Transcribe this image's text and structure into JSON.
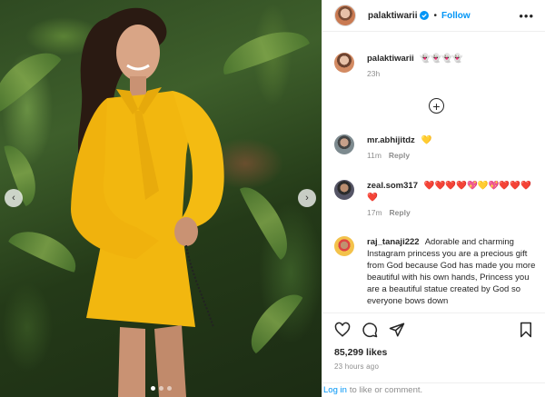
{
  "post": {
    "username": "palaktiwarii",
    "follow_label": "Follow",
    "bullet": "•",
    "more_label": "•••",
    "verified_icon": "verified-badge-icon",
    "accent": "#0095f6"
  },
  "photo": {
    "prev_glyph": "‹",
    "next_glyph": "›",
    "slide_count": 3,
    "active_slide": 1
  },
  "caption": {
    "username": "palaktiwarii",
    "text": "👻👻👻👻",
    "time": "23h"
  },
  "view_replies_glyph": "+",
  "comments": [
    {
      "username": "mr.abhijitdz",
      "text": "💛",
      "time": "11m",
      "reply_label": "Reply"
    },
    {
      "username": "zeal.som317",
      "text": "❤️❤️❤️❤️💖💛💖❤️❤️❤️❤️",
      "time": "17m",
      "reply_label": "Reply"
    },
    {
      "username": "raj_tanaji222",
      "text": "Adorable and charming Instagram princess you are a precious gift from God because God has made you more beautiful with his own hands, Princess you are a beautiful statue created by God so everyone bows down",
      "time": "",
      "reply_label": ""
    }
  ],
  "actions": {
    "like_icon": "heart-icon",
    "comment_icon": "comment-icon",
    "share_icon": "share-icon",
    "save_icon": "bookmark-icon"
  },
  "likes": "85,299 likes",
  "time_ago": "23 hours ago",
  "login": {
    "link": "Log in",
    "text": "to like or comment."
  }
}
